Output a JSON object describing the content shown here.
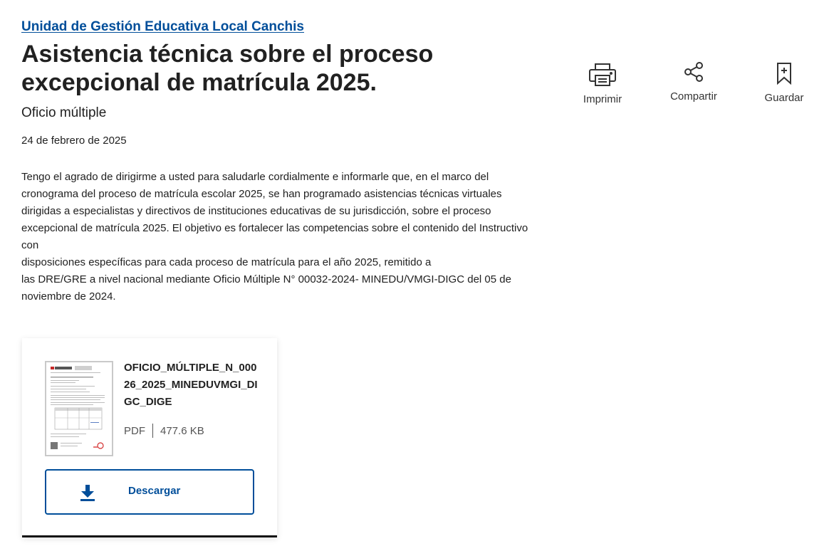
{
  "header": {
    "institution": "Unidad de Gestión Educativa Local Canchis",
    "title": "Asistencia técnica sobre el proceso excepcional de matrícula 2025.",
    "doc_type": "Oficio múltiple",
    "date": "24 de febrero de 2025"
  },
  "body": {
    "lines": [
      "Tengo el agrado de dirigirme a usted para saludarle cordialmente e informarle que, en el marco del cronograma del proceso de matrícula escolar 2025, se han programado asistencias técnicas virtuales dirigidas a especialistas y directivos de instituciones educativas de su jurisdicción, sobre el proceso excepcional de matrícula 2025. El objetivo es fortalecer las competencias sobre el contenido del Instructivo con",
      "disposiciones específicas para cada proceso de matrícula para el año 2025, remitido a",
      "las DRE/GRE a nivel nacional mediante Oficio Múltiple N° 00032-2024- MINEDU/VMGI-DIGC del 05 de noviembre de 2024."
    ]
  },
  "actions": {
    "print_label": "Imprimir",
    "share_label": "Compartir",
    "save_label": "Guardar"
  },
  "file": {
    "name": "OFICIO_MÚLTIPLE_N_00026_2025_MINEDUVMGI_DIGC_DIGE",
    "format": "PDF",
    "size": "477.6 KB",
    "download_label": "Descargar"
  },
  "colors": {
    "accent": "#004e9a",
    "text": "#212121"
  }
}
